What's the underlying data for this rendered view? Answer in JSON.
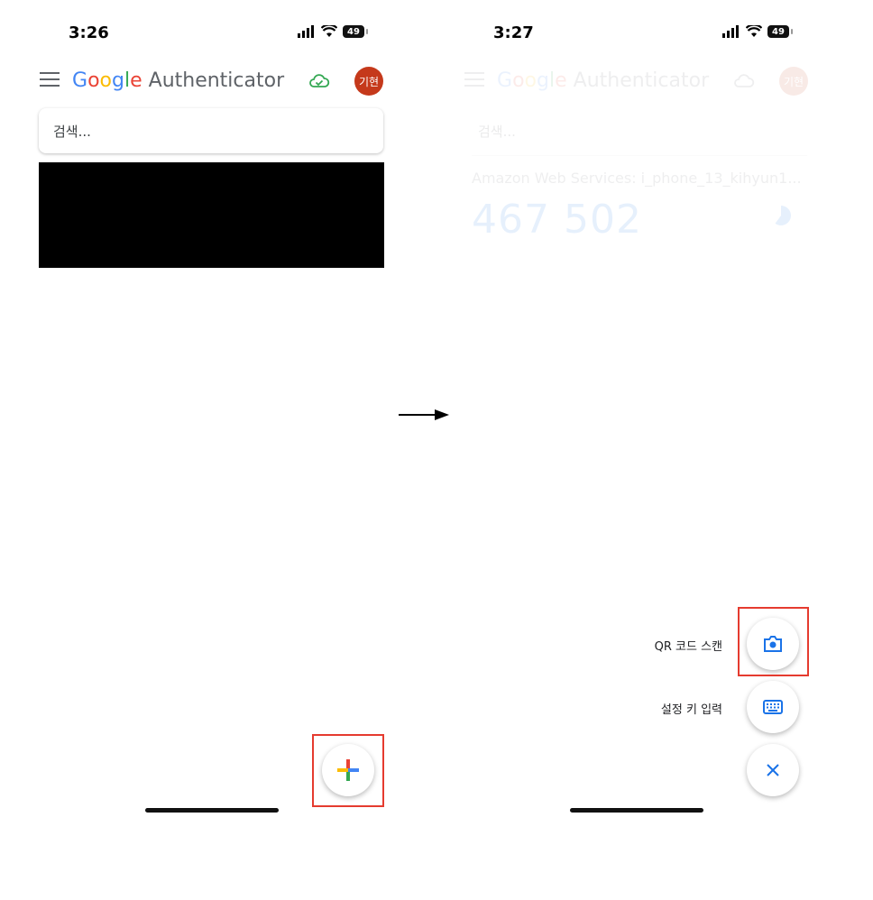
{
  "left_screen": {
    "status": {
      "time": "3:26",
      "battery": "49"
    },
    "appbar": {
      "brand_google": [
        "G",
        "o",
        "o",
        "g",
        "l",
        "e"
      ],
      "brand_product": "Authenticator",
      "avatar_initials": "기현"
    },
    "search": {
      "placeholder": "검색..."
    },
    "fab": {
      "icon": "plus-icon"
    }
  },
  "right_screen": {
    "status": {
      "time": "3:27",
      "battery": "49"
    },
    "appbar": {
      "brand_google": [
        "G",
        "o",
        "o",
        "g",
        "l",
        "e"
      ],
      "brand_product": "Authenticator",
      "avatar_initials": "기현"
    },
    "search": {
      "placeholder": "검색..."
    },
    "account": {
      "name": "Amazon Web Services: i_phone_13_kihyun1...",
      "code": "467 502"
    },
    "speed_dial": {
      "qr_label": "QR 코드 스캔",
      "key_label": "설정 키 입력",
      "close_icon": "close-icon"
    }
  },
  "colors": {
    "google_blue": "#4285F4",
    "google_red": "#EA4335",
    "google_yellow": "#FBBC05",
    "google_green": "#34A853",
    "highlight": "#e53b2f",
    "avatar_bg": "#c5391b",
    "accent": "#1a73e8"
  }
}
